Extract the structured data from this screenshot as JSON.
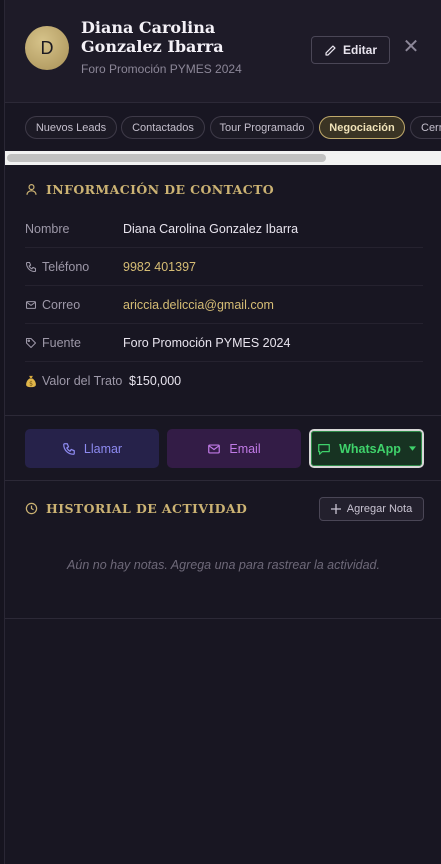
{
  "contact": {
    "avatar_initial": "D",
    "name": "Diana Carolina Gonzalez Ibarra",
    "subtitle": "Foro Promoción PYMES 2024"
  },
  "header": {
    "edit_label": "Editar",
    "close_symbol": "✕"
  },
  "tabs": [
    {
      "label": "Nuevos Leads",
      "active": false
    },
    {
      "label": "Contactados",
      "active": false
    },
    {
      "label": "Tour Programado",
      "active": false
    },
    {
      "label": "Negociación",
      "active": true
    },
    {
      "label": "Cerrado",
      "active": false
    }
  ],
  "contact_info": {
    "title": "Información de Contacto",
    "rows": [
      {
        "label": "Nombre",
        "value": "Diana Carolina Gonzalez Ibarra",
        "icon": ""
      },
      {
        "label": "Teléfono",
        "value": "9982 401397",
        "icon": "phone-icon"
      },
      {
        "label": "Correo",
        "value": "ariccia.deliccia@gmail.com",
        "icon": "mail-icon"
      },
      {
        "label": "Fuente",
        "value": "Foro Promoción PYMES 2024",
        "icon": "tag-icon"
      },
      {
        "label": "Valor del Trato",
        "value": "$150,000",
        "icon": "money-bag-icon"
      }
    ]
  },
  "actions": {
    "call_label": "Llamar",
    "email_label": "Email",
    "whatsapp_label": "WhatsApp"
  },
  "activity": {
    "title": "Historial de Actividad",
    "add_note_label": "Agregar Nota",
    "empty_text": "Aún no hay notas. Agrega una para rastrear la actividad."
  },
  "colors": {
    "accent_gold": "#cbb273",
    "call": "#8d8af0",
    "email": "#c07ae6",
    "whatsapp": "#3fd26b"
  }
}
